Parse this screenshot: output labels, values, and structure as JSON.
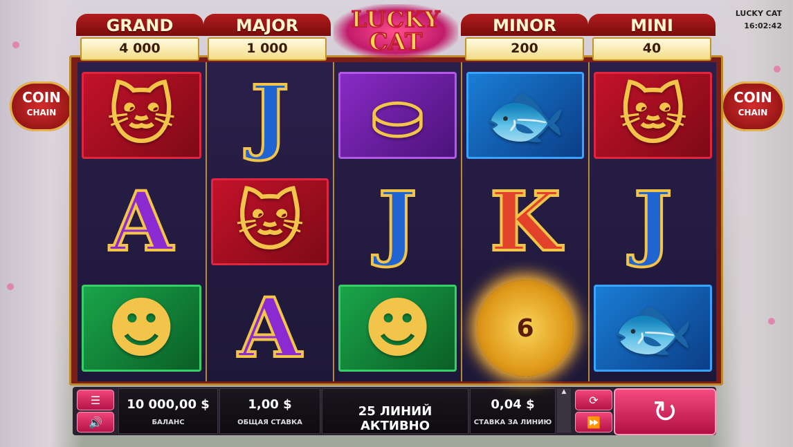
{
  "game": {
    "title": "LUCKY CAT",
    "clock": "16:02:42"
  },
  "logo": {
    "line1": "LUCKY",
    "line2": "CAT"
  },
  "jackpots": [
    {
      "name": "GRAND",
      "value": "4 000"
    },
    {
      "name": "MAJOR",
      "value": "1 000"
    },
    {
      "name": "MINOR",
      "value": "200"
    },
    {
      "name": "MINI",
      "value": "40"
    }
  ],
  "lanterns": {
    "left_line1": "COIN",
    "left_line2": "CHAIN",
    "right_line1": "COIN",
    "right_line2": "CHAIN"
  },
  "reels": [
    [
      {
        "symbol": "lucky-cat",
        "tile": "red"
      },
      {
        "symbol": "A",
        "tile": "none"
      },
      {
        "symbol": "buddha",
        "tile": "green"
      }
    ],
    [
      {
        "symbol": "J",
        "tile": "none"
      },
      {
        "symbol": "lucky-cat",
        "tile": "red"
      },
      {
        "symbol": "A",
        "tile": "none"
      }
    ],
    [
      {
        "symbol": "gold-ingot",
        "tile": "purple"
      },
      {
        "symbol": "J",
        "tile": "none"
      },
      {
        "symbol": "buddha",
        "tile": "green"
      }
    ],
    [
      {
        "symbol": "koi-fish",
        "tile": "blue"
      },
      {
        "symbol": "K",
        "tile": "none"
      },
      {
        "symbol": "coin",
        "tile": "none",
        "value": "6"
      }
    ],
    [
      {
        "symbol": "lucky-cat",
        "tile": "red"
      },
      {
        "symbol": "J",
        "tile": "none"
      },
      {
        "symbol": "koi-fish",
        "tile": "blue"
      }
    ]
  ],
  "bottom_bar": {
    "balance_value": "10 000,00 $",
    "balance_label": "БАЛАНС",
    "total_bet_value": "1,00 $",
    "total_bet_label": "ОБЩАЯ СТАВКА",
    "lines_text": "25 ЛИНИЙ АКТИВНО",
    "line_bet_value": "0,04 $",
    "line_bet_label": "СТАВКА ЗА ЛИНИЮ"
  },
  "icons": {
    "menu": "menu-icon",
    "sound": "sound-icon",
    "autoplay": "autoplay-icon",
    "turbo": "fast-forward-icon",
    "spin": "spin-icon"
  }
}
